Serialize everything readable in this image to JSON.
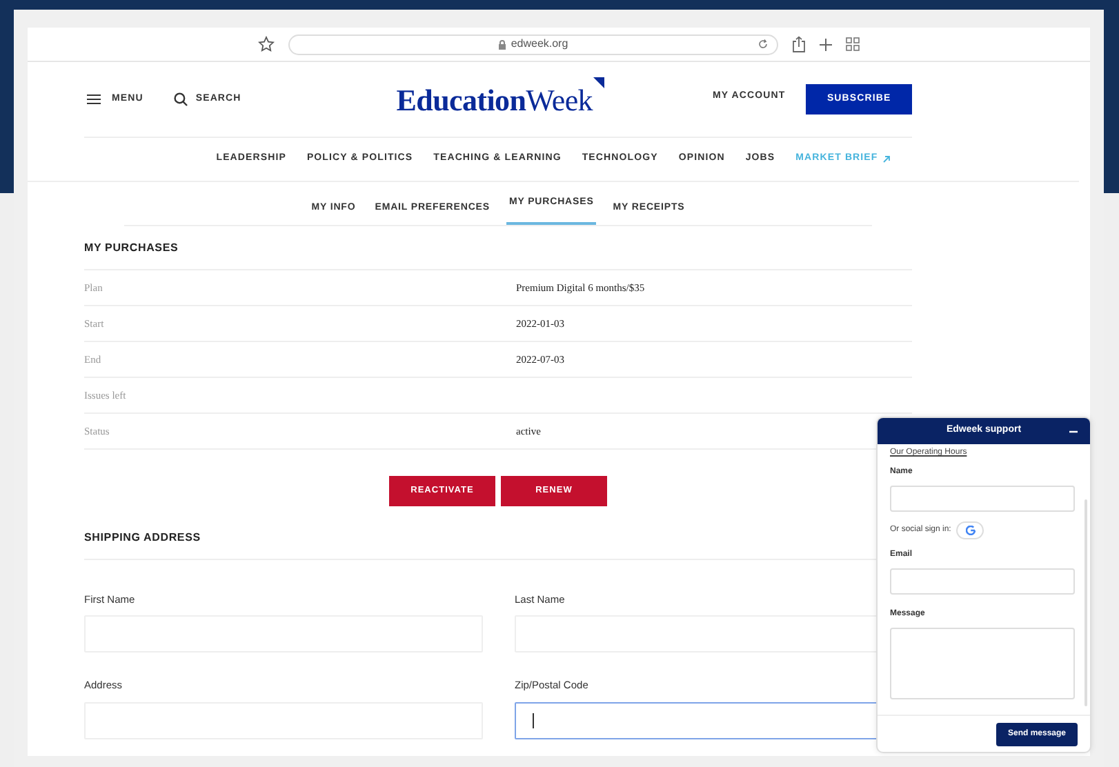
{
  "browser": {
    "url": "edweek.org"
  },
  "header": {
    "menu": "MENU",
    "search": "SEARCH",
    "logo": "**Education**Week",
    "account": "MY ACCOUNT",
    "subscribe": "SUBSCRIBE"
  },
  "nav": [
    {
      "label": "LEADERSHIP",
      "kind": "section"
    },
    {
      "label": "POLICY & POLITICS",
      "kind": "section"
    },
    {
      "label": "TEACHING & LEARNING",
      "kind": "section"
    },
    {
      "label": "TECHNOLOGY",
      "kind": "section"
    },
    {
      "label": "OPINION",
      "kind": "section"
    },
    {
      "label": "JOBS",
      "kind": "section"
    },
    {
      "label": "MARKET BRIEF",
      "kind": "external"
    }
  ],
  "tabs": [
    {
      "label": "MY INFO",
      "selected": false
    },
    {
      "label": "EMAIL PREFERENCES",
      "selected": false
    },
    {
      "label": "MY PURCHASES",
      "selected": true
    },
    {
      "label": "MY RECEIPTS",
      "selected": false
    }
  ],
  "purchases": {
    "title": "MY PURCHASES",
    "rows": [
      {
        "label": "Plan",
        "value": "Premium Digital 6 months/$35"
      },
      {
        "label": "Start",
        "value": "2022-01-03"
      },
      {
        "label": "End",
        "value": "2022-07-03"
      },
      {
        "label": "Issues left"
      },
      {
        "label": "Status",
        "value": "active"
      }
    ],
    "buttons": [
      "REACTIVATE",
      "RENEW"
    ]
  },
  "shipping": {
    "title": "SHIPPING ADDRESS",
    "fields": [
      {
        "label": "First Name",
        "focused": false
      },
      {
        "label": "Last Name",
        "focused": false
      },
      {
        "label": "Address",
        "focused": false
      },
      {
        "label": "Zip/Postal Code",
        "focused": true
      }
    ]
  },
  "chat": {
    "title": "Edweek support",
    "hours_link": "Our Operating Hours",
    "name_label": "Name",
    "social_label": "Or social sign in:",
    "email_label": "Email",
    "message_label": "Message",
    "send": "Send message"
  }
}
